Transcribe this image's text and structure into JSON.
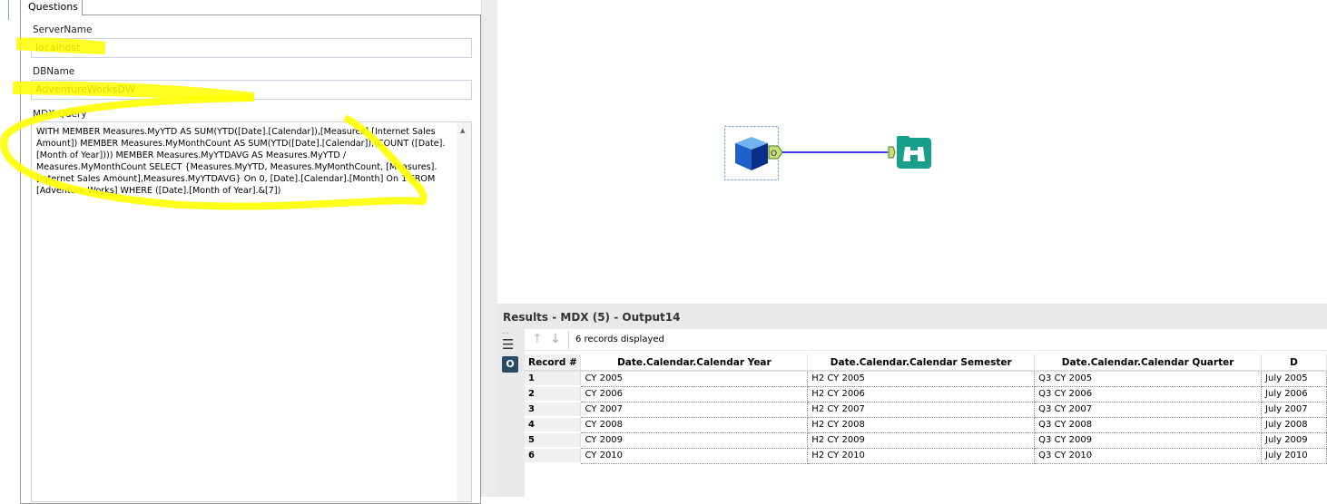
{
  "config": {
    "tab": "Questions",
    "server_label": "ServerName",
    "server_value": "localhost",
    "db_label": "DBName",
    "db_value": "AdventureWorksDW",
    "mdx_label": "MDX Query",
    "mdx_value": "WITH MEMBER Measures.MyYTD AS SUM(YTD([Date].[Calendar]),[Measures].[Internet Sales Amount]) MEMBER Measures.MyMonthCount AS SUM(YTD([Date].[Calendar]),(COUNT ([Date].[Month of Year]))) MEMBER Measures.MyYTDAVG AS Measures.MyYTD / Measures.MyMonthCount SELECT  {Measures.MyYTD, Measures.MyMonthCount, [Measures].[Internet Sales Amount],Measures.MyYTDAVG} On 0, [Date].[Calendar].[Month] On 1 FROM [Adventure Works] WHERE ([Date].[Month of Year].&[7])"
  },
  "workflow": {
    "output_anchor": "O",
    "highlight_color": "#ffff00",
    "connector_color": "#3a3ae8"
  },
  "results": {
    "title": "Results - MDX (5) - Output14",
    "side_dots": "...",
    "output_icon": "O",
    "records_text": "6 records displayed",
    "columns": [
      "Record #",
      "Date.Calendar.Calendar Year",
      "Date.Calendar.Calendar Semester",
      "Date.Calendar.Calendar Quarter",
      "D"
    ],
    "rows": [
      [
        "1",
        "CY 2005",
        "H2 CY 2005",
        "Q3 CY 2005",
        "July 2005"
      ],
      [
        "2",
        "CY 2006",
        "H2 CY 2006",
        "Q3 CY 2006",
        "July 2006"
      ],
      [
        "3",
        "CY 2007",
        "H2 CY 2007",
        "Q3 CY 2007",
        "July 2007"
      ],
      [
        "4",
        "CY 2008",
        "H2 CY 2008",
        "Q3 CY 2008",
        "July 2008"
      ],
      [
        "5",
        "CY 2009",
        "H2 CY 2009",
        "Q3 CY 2009",
        "July 2009"
      ],
      [
        "6",
        "CY 2010",
        "H2 CY 2010",
        "Q3 CY 2010",
        "July 2010"
      ]
    ]
  }
}
